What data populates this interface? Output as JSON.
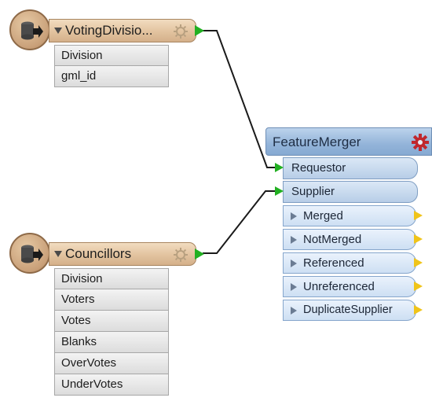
{
  "readers": [
    {
      "title": "VotingDivisio...",
      "icon": "database-reader-icon",
      "attributes": [
        "Division",
        "gml_id"
      ]
    },
    {
      "title": "Councillors",
      "icon": "database-reader-icon",
      "attributes": [
        "Division",
        "Voters",
        "Votes",
        "Blanks",
        "OverVotes",
        "UnderVotes"
      ]
    }
  ],
  "transformer": {
    "title": "FeatureMerger",
    "icon": "gear-icon",
    "input_ports": [
      "Requestor",
      "Supplier"
    ],
    "output_ports": [
      "Merged",
      "NotMerged",
      "Referenced",
      "Unreferenced",
      "DuplicateSupplier"
    ]
  },
  "colors": {
    "reader_header": "#e2c39f",
    "transformer_header": "#93b4d9",
    "input_port_arrow": "#22b022",
    "output_port_flag": "#f0c419",
    "transformer_gear": "#c0272d"
  }
}
